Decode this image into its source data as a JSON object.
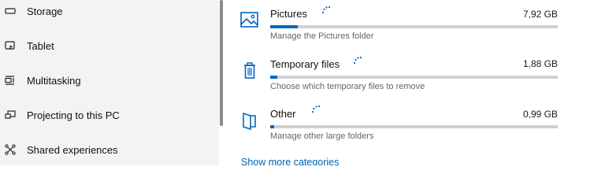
{
  "sidebar": {
    "items": [
      {
        "label": "Storage",
        "icon": "storage-icon"
      },
      {
        "label": "Tablet",
        "icon": "tablet-icon"
      },
      {
        "label": "Multitasking",
        "icon": "multitasking-icon"
      },
      {
        "label": "Projecting to this PC",
        "icon": "projecting-icon"
      },
      {
        "label": "Shared experiences",
        "icon": "shared-experiences-icon"
      }
    ]
  },
  "categories": [
    {
      "name": "Pictures",
      "size": "7,92 GB",
      "description": "Manage the Pictures folder",
      "icon": "pictures-icon",
      "usage_fraction": 0.095
    },
    {
      "name": "Temporary files",
      "size": "1,88 GB",
      "description": "Choose which temporary files to remove",
      "icon": "trash-icon",
      "usage_fraction": 0.025
    },
    {
      "name": "Other",
      "size": "0,99 GB",
      "description": "Manage other large folders",
      "icon": "folder-icon",
      "usage_fraction": 0.013
    }
  ],
  "show_more": "Show more categories",
  "colors": {
    "accent": "#0067c0",
    "bar_track": "#d0d0d0",
    "sidebar_bg": "#f3f3f3",
    "link": "#0063b1"
  }
}
